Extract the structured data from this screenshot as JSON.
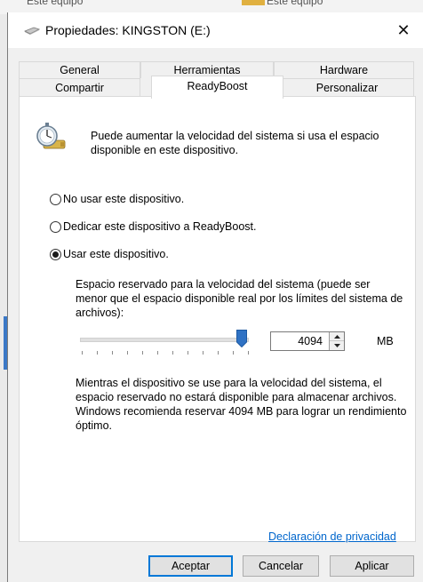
{
  "background": {
    "left_text": "Este equipo",
    "right_text": "Este equipo"
  },
  "window": {
    "title": "Propiedades: KINGSTON (E:)",
    "close_symbol": "✕"
  },
  "tabs": {
    "row1": [
      "General",
      "Herramientas",
      "Hardware"
    ],
    "row2": [
      "Compartir",
      "ReadyBoost",
      "Personalizar"
    ],
    "active": "ReadyBoost"
  },
  "readyboost": {
    "intro": "Puede aumentar la velocidad del sistema si usa el espacio disponible en este dispositivo.",
    "options": [
      {
        "label": "No usar este dispositivo.",
        "checked": false
      },
      {
        "label": "Dedicar este dispositivo a ReadyBoost.",
        "checked": false
      },
      {
        "label": "Usar este dispositivo.",
        "checked": true
      }
    ],
    "reserve_description": "Espacio reservado para la velocidad del sistema (puede ser menor que el espacio disponible real por los límites del sistema de archivos):",
    "slider_fraction": 0.97,
    "reserve_value": "4094",
    "unit": "MB",
    "note_line1": "Mientras el dispositivo se use para la velocidad del sistema, el espacio reservado no estará disponible para almacenar archivos.",
    "note_line2": "Windows recomienda reservar 4094 MB para lograr un rendimiento óptimo.",
    "privacy_link": "Declaración de privacidad"
  },
  "buttons": {
    "ok": "Aceptar",
    "cancel": "Cancelar",
    "apply": "Aplicar"
  },
  "colors": {
    "accent": "#0078d7",
    "link": "#0066cc",
    "thumb": "#2f72c4"
  }
}
